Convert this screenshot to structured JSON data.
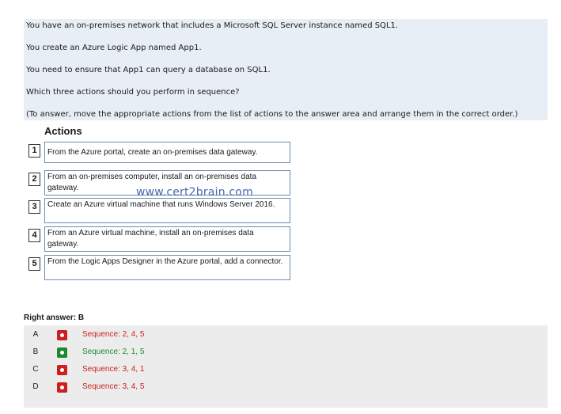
{
  "question": {
    "line1": "You have an on-premises network that includes a Microsoft SQL Server instance named SQL1.",
    "line2": "You create an Azure Logic App named App1.",
    "line3": "You need to ensure that App1 can query a database on SQL1.",
    "line4": "Which three actions should you perform in sequence?",
    "line5": "(To answer, move the appropriate actions from the list of actions to the answer area and arrange them in the correct order.)"
  },
  "actions": {
    "title": "Actions",
    "items": [
      {
        "number": "1",
        "text": "From the Azure portal, create an on-premises data gateway."
      },
      {
        "number": "2",
        "text": "From an on-premises computer, install an on-premises data gateway."
      },
      {
        "number": "3",
        "text": "Create an Azure virtual machine that runs Windows Server 2016."
      },
      {
        "number": "4",
        "text": "From an Azure virtual machine, install an on-premises data gateway."
      },
      {
        "number": "5",
        "text": "From the Logic Apps Designer in the Azure portal, add a connector."
      }
    ]
  },
  "watermark": "www.cert2brain.com",
  "right_answer": "Right answer: B",
  "options": [
    {
      "letter": "A",
      "text": "Sequence: 2, 4, 5",
      "correct": false,
      "color": "#cc1f1f"
    },
    {
      "letter": "B",
      "text": "Sequence: 2, 1, 5",
      "correct": true,
      "color": "#1d8a2d"
    },
    {
      "letter": "C",
      "text": "Sequence: 3, 4, 1",
      "correct": false,
      "color": "#cc1f1f"
    },
    {
      "letter": "D",
      "text": "Sequence: 3, 4, 5",
      "correct": false,
      "color": "#cc1f1f"
    }
  ]
}
